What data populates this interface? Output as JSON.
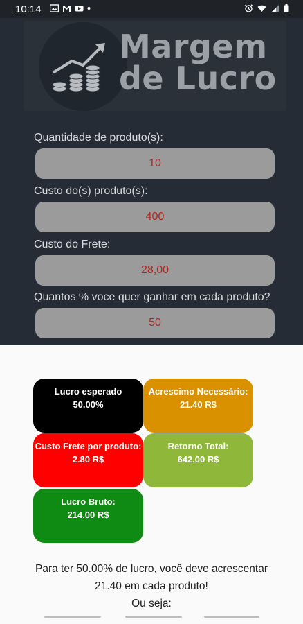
{
  "status_bar": {
    "time": "10:14"
  },
  "logo": {
    "line1": "Margem",
    "line2": "de Lucro"
  },
  "form": {
    "fields": [
      {
        "label": "Quantidade de produto(s):",
        "value": "10"
      },
      {
        "label": "Custo do(s) produto(s):",
        "value": "400"
      },
      {
        "label": "Custo do Frete:",
        "value": "28,00"
      },
      {
        "label": "Quantos % voce quer ganhar em cada produto?",
        "value": "50"
      }
    ]
  },
  "results": {
    "lucro_esperado": {
      "title": "Lucro esperado",
      "value": "50.00%"
    },
    "acrescimo": {
      "title": "Acrescimo Necessário:",
      "value": "21.40 R$"
    },
    "custo_frete": {
      "title": "Custo Frete por produto:",
      "value": "2.80 R$"
    },
    "retorno_total": {
      "title": "Retorno Total:",
      "value": "642.00 R$"
    },
    "lucro_bruto": {
      "title": "Lucro Bruto:",
      "value": "214.00 R$"
    }
  },
  "summary": {
    "line1": "Para ter 50.00% de lucro, você deve acrescentar",
    "line2": "21.40 em cada produto!",
    "line3": "Ou seja:"
  },
  "colors": {
    "lucro_esperado": "#000000",
    "acrescimo": "#d99100",
    "custo_frete": "#ff0000",
    "retorno_total": "#8fb83a",
    "lucro_bruto": "#0f8a12"
  }
}
